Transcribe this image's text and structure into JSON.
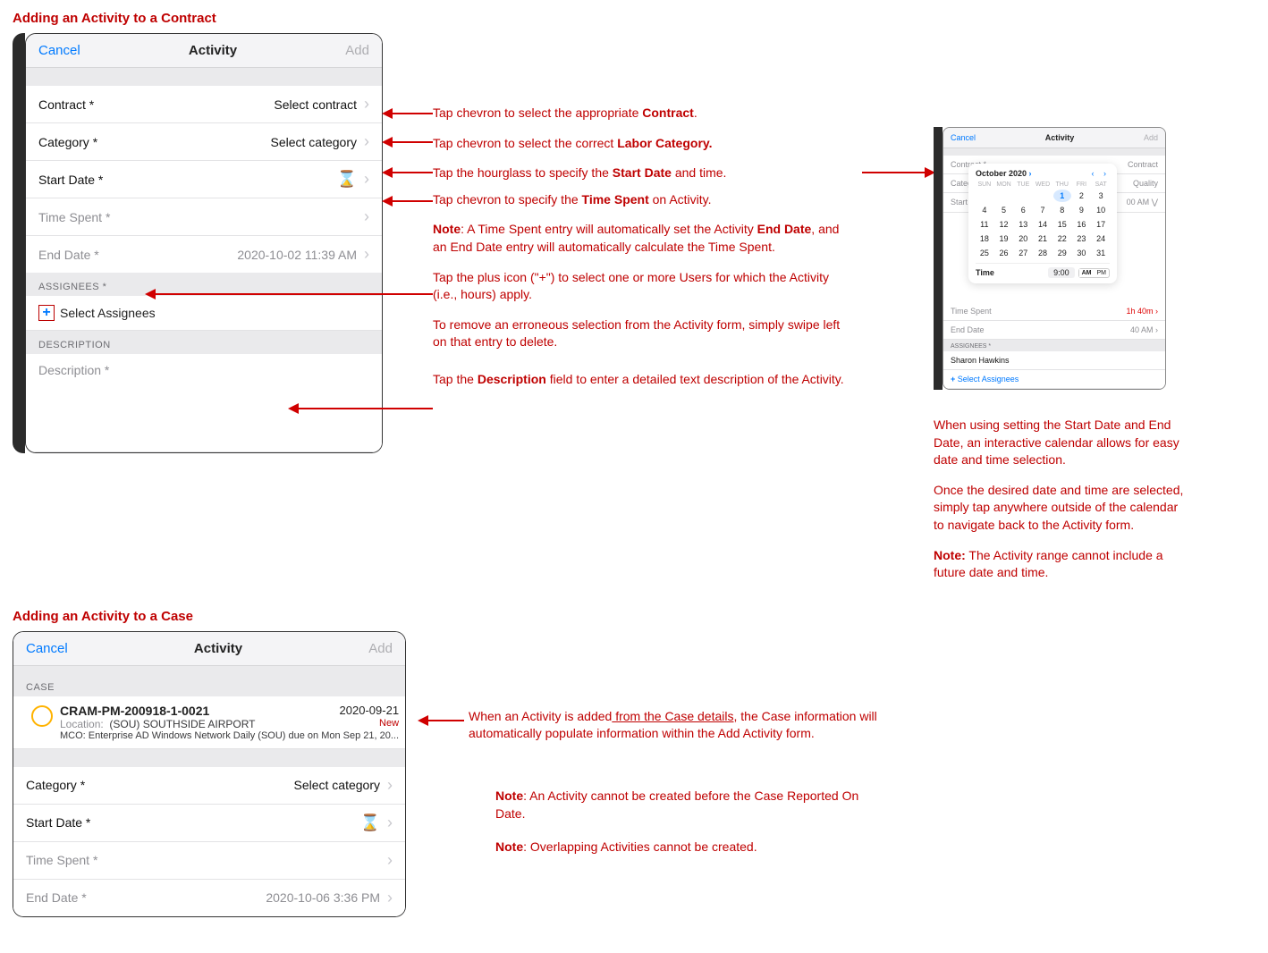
{
  "section1_title": "Adding an Activity to a Contract",
  "section2_title": "Adding an Activity to a Case",
  "titlebar": {
    "cancel": "Cancel",
    "title": "Activity",
    "add": "Add"
  },
  "form1": {
    "contract_label": "Contract *",
    "contract_value": "Select contract",
    "category_label": "Category *",
    "category_value": "Select category",
    "startdate_label": "Start Date *",
    "timespent_label": "Time Spent *",
    "enddate_label": "End Date *",
    "enddate_value": "2020-10-02 11:39 AM",
    "assignees_header": "ASSIGNEES *",
    "select_assignees": "Select Assignees",
    "description_header": "DESCRIPTION",
    "description_placeholder": "Description *"
  },
  "annot1": {
    "a1_pre": "Tap chevron to select the appropriate ",
    "a1_b": "Contract",
    "a1_post": ".",
    "a2_pre": "Tap chevron to select the correct ",
    "a2_b": "Labor Category.",
    "a3_pre": "Tap the hourglass to specify the ",
    "a3_b": "Start Date",
    "a3_post": " and time.",
    "a4_pre": "Tap chevron to specify the ",
    "a4_b": "Time Spent",
    "a4_post": " on Activity.",
    "n1_b": "Note",
    "n1_mid": ": A Time Spent entry will automatically set the Activity ",
    "n1_b2": "End Date",
    "n1_post": ", and an End Date entry will automatically calculate the Time Spent.",
    "a5": "Tap the plus icon (\"+\") to select one or more Users for which the Activity (i.e., hours) apply.",
    "a5b": "To remove an erroneous selection from the Activity form, simply swipe left on that entry to delete.",
    "a6_pre": "Tap the ",
    "a6_b": "Description",
    "a6_post": " field to enter a detailed text description of the Activity."
  },
  "calpanel": {
    "contract_label": "Contract *",
    "contract_val": "Contract",
    "category_label": "Category *",
    "category_val": "Quality",
    "startdate_label": "Start Date",
    "startdate_val": "00 AM   ⋁",
    "timespent_label": "Time Spent",
    "timespent_val": "1h 40m  ›",
    "enddate_label": "End Date",
    "enddate_val": "40 AM  ›",
    "assignees_header": "ASSIGNEES *",
    "assignee_name": "Sharon Hawkins",
    "select_assignees": "Select Assignees",
    "month": "October 2020",
    "time_label": "Time",
    "time_val": "9:00",
    "am": "AM",
    "pm": "PM",
    "dows": [
      "SUN",
      "MON",
      "TUE",
      "WED",
      "THU",
      "FRI",
      "SAT"
    ]
  },
  "caltext": {
    "p1": "When using setting the Start Date and End Date, an interactive calendar allows for easy date and time selection.",
    "p2": "Once the desired date and time are selected, simply tap anywhere outside of the calendar to navigate back to the Activity form.",
    "p3_b": "Note:",
    "p3": " The Activity range cannot include a future date and time."
  },
  "case": {
    "section": "CASE",
    "id": "CRAM-PM-200918-1-0021",
    "date": "2020-09-21",
    "loc_label": "Location:",
    "loc_val": "(SOU) SOUTHSIDE AIRPORT",
    "status_new": "New",
    "sched": "MCO: Enterprise AD Windows Network Daily (SOU) due on Mon Sep 21, 20..."
  },
  "form2": {
    "category_label": "Category *",
    "category_value": "Select category",
    "startdate_label": "Start Date *",
    "timespent_label": "Time Spent *",
    "enddate_label": "End Date *",
    "enddate_value": "2020-10-06 3:36 PM"
  },
  "annot2": {
    "a1_pre": "When an Activity is added",
    "a1_u": " from the Case details",
    "a1_post": ", the Case information will automatically populate information within the Add Activity form.",
    "n1_b": "Note",
    "n1": ": An Activity cannot be created before the Case Reported On Date.",
    "n2_b": "Note",
    "n2": ": Overlapping Activities cannot be created."
  }
}
